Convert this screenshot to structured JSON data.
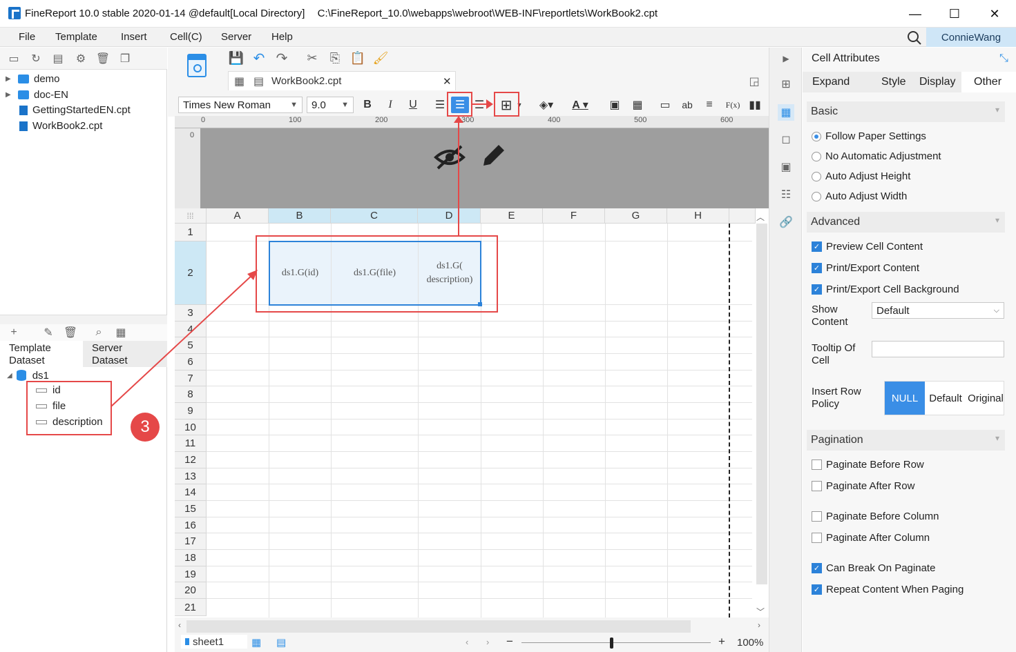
{
  "window": {
    "title": "FineReport 10.0 stable 2020-01-14 @default[Local Directory]",
    "path": "C:\\FineReport_10.0\\webapps\\webroot\\WEB-INF\\reportlets\\WorkBook2.cpt",
    "min": "—",
    "max": "☐",
    "close": "✕"
  },
  "menu": {
    "items": [
      "File",
      "Template",
      "Insert",
      "Cell(C)",
      "Server",
      "Help"
    ],
    "user": "ConnieWang"
  },
  "tree": {
    "items": [
      "demo",
      "doc-EN",
      "GettingStartedEN.cpt",
      "WorkBook2.cpt"
    ]
  },
  "dataset": {
    "tabs": [
      "Template\nDataset",
      "Server\nDataset"
    ],
    "ds_name": "ds1",
    "fields": [
      "id",
      "file",
      "description"
    ],
    "badge": "3"
  },
  "editor": {
    "tab_label": "WorkBook2.cpt",
    "font": "Times New Roman",
    "font_size": "9.0",
    "bold": "B",
    "italic": "I",
    "underline": "U",
    "fx": "F(x)",
    "ab": "ab",
    "ruler": [
      "0",
      "100",
      "200",
      "300",
      "400",
      "500",
      "600"
    ],
    "vruler": "0",
    "columns": [
      "A",
      "B",
      "C",
      "D",
      "E",
      "F",
      "G",
      "H"
    ],
    "rows": [
      "1",
      "2",
      "3",
      "4",
      "5",
      "6",
      "7",
      "8",
      "9",
      "10",
      "11",
      "12",
      "13",
      "14",
      "15",
      "16",
      "17",
      "18",
      "19",
      "20",
      "21"
    ],
    "cells": {
      "B2": "ds1.G(id)",
      "C2": "ds1.G(file)",
      "D2": "ds1.G(\ndescription)"
    },
    "sheet": "sheet1",
    "zoom_minus": "−",
    "zoom_plus": "+",
    "zoom": "100%"
  },
  "right_panel": {
    "title": "Cell Attributes",
    "tabs": [
      "Expand",
      "Style",
      "Display",
      "Other"
    ],
    "active_tab": "Other",
    "basic": {
      "header": "Basic",
      "options": [
        "Follow Paper Settings",
        "No Automatic Adjustment",
        "Auto Adjust Height",
        "Auto Adjust Width"
      ],
      "selected": "Follow Paper Settings"
    },
    "advanced": {
      "header": "Advanced",
      "checks": [
        {
          "label": "Preview Cell Content",
          "checked": true
        },
        {
          "label": "Print/Export Content",
          "checked": true
        },
        {
          "label": "Print/Export Cell Background",
          "checked": true
        }
      ],
      "show_content_label": "Show\nContent",
      "show_content_value": "Default",
      "tooltip_label": "Tooltip Of\nCell",
      "tooltip_value": "",
      "insert_row_label": "Insert Row\nPolicy",
      "insert_row_options": [
        "NULL",
        "Default",
        "Original"
      ],
      "insert_row_selected": "NULL"
    },
    "pagination": {
      "header": "Pagination",
      "checks": [
        {
          "label": "Paginate Before Row",
          "checked": false
        },
        {
          "label": "Paginate After Row",
          "checked": false
        },
        {
          "label": "Paginate Before Column",
          "checked": false
        },
        {
          "label": "Paginate After Column",
          "checked": false
        },
        {
          "label": "Can Break On Paginate",
          "checked": true
        },
        {
          "label": "Repeat Content When Paging",
          "checked": true
        }
      ]
    }
  },
  "colors": {
    "accent": "#2c82d9",
    "annotation": "#e54848",
    "selection": "#cde8f5"
  }
}
